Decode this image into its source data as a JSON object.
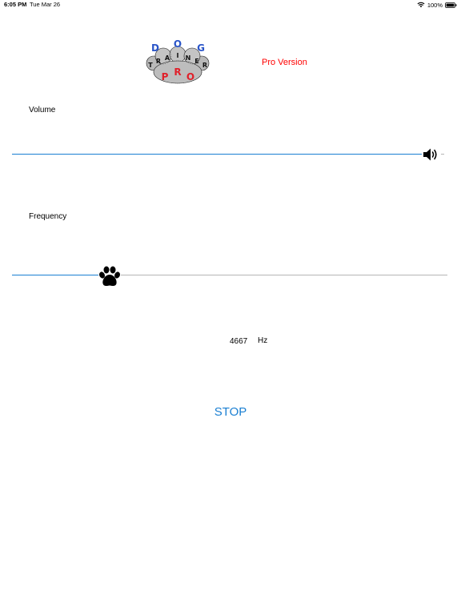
{
  "status_bar": {
    "time": "6:05 PM",
    "date": "Tue Mar 26",
    "battery": "100%",
    "icons": [
      "wifi-icon",
      "battery-icon"
    ]
  },
  "header": {
    "logo": {
      "letters_top": [
        "D",
        "O",
        "G"
      ],
      "letters_middle": [
        "T",
        "R",
        "A",
        "I",
        "N",
        "E",
        "R"
      ],
      "letters_bottom": [
        "P",
        "R",
        "O"
      ]
    },
    "pro_version": "Pro Version"
  },
  "volume": {
    "label": "Volume",
    "level": 0.95,
    "thumb_icon": "speaker-volume-icon"
  },
  "frequency": {
    "label": "Frequency",
    "level": 0.2,
    "thumb_icon": "paw-icon",
    "value": "4667",
    "unit": "Hz"
  },
  "controls": {
    "stop_label": "STOP"
  },
  "colors": {
    "accent": "#1a7fd2",
    "pro_text": "#ff0000",
    "track_inactive": "#b5b5b5",
    "logo_blue": "#2a55c8",
    "logo_red": "#e0202a"
  }
}
